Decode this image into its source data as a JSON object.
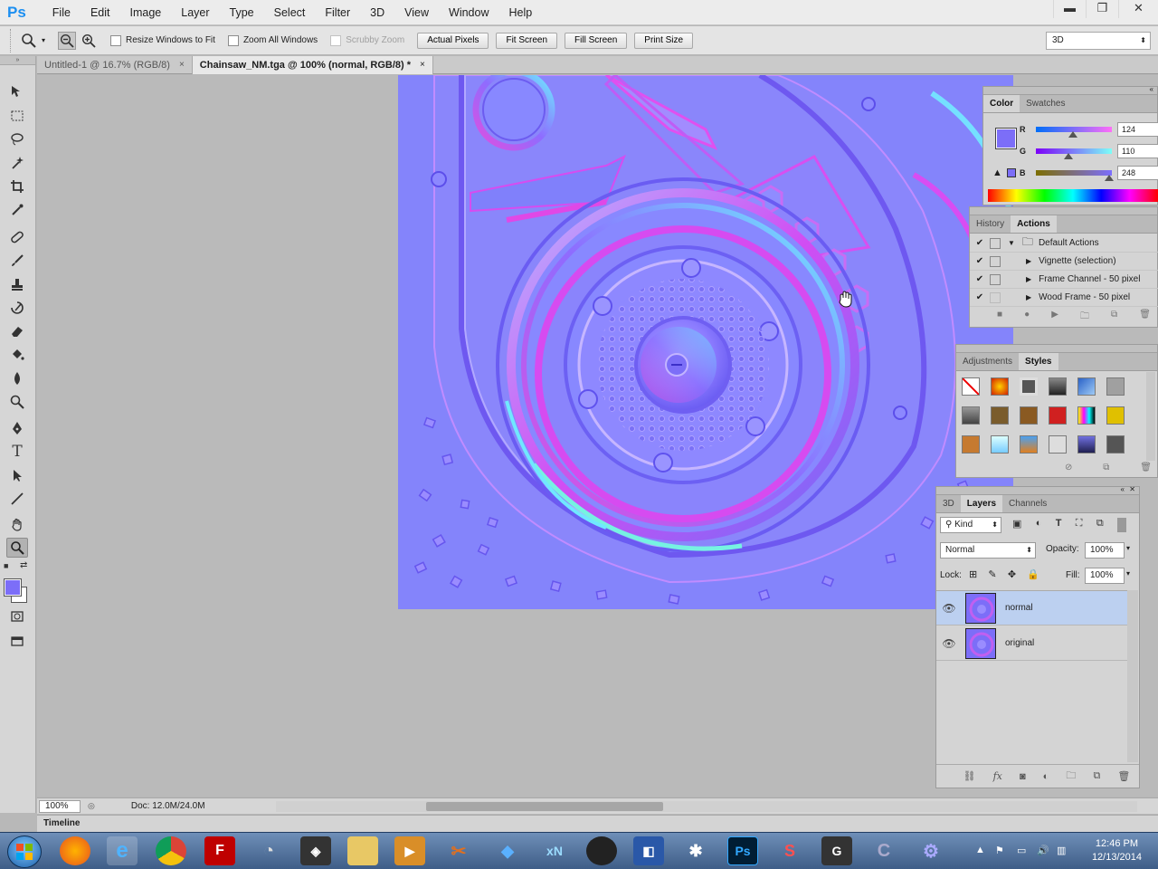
{
  "app": {
    "logo": "Ps",
    "menu": [
      "File",
      "Edit",
      "Image",
      "Layer",
      "Type",
      "Select",
      "Filter",
      "3D",
      "View",
      "Window",
      "Help"
    ],
    "window_controls": {
      "minimize": "▬",
      "restore": "❐",
      "close": "✕"
    }
  },
  "options_bar": {
    "resize_windows": "Resize Windows to Fit",
    "zoom_all": "Zoom All Windows",
    "scrubby": "Scrubby Zoom",
    "buttons": [
      "Actual Pixels",
      "Fit Screen",
      "Fill Screen",
      "Print Size"
    ],
    "workspace": "3D"
  },
  "tabs": [
    {
      "label": "Untitled-1 @ 16.7% (RGB/8)",
      "close": "×"
    },
    {
      "label": "Chainsaw_NM.tga @ 100% (normal, RGB/8) *",
      "close": "×"
    }
  ],
  "status": {
    "zoom": "100%",
    "doc": "Doc: 12.0M/24.0M"
  },
  "timeline": {
    "label": "Timeline"
  },
  "color_panel": {
    "tabs": [
      "Color",
      "Swatches"
    ],
    "channels": [
      {
        "label": "R",
        "value": "124",
        "level": 0.49
      },
      {
        "label": "G",
        "value": "110",
        "level": 0.43
      },
      {
        "label": "B",
        "value": "248",
        "level": 0.97
      }
    ],
    "fg_color": "#7c6ef8"
  },
  "actions_panel": {
    "tabs": [
      "History",
      "Actions"
    ],
    "items": [
      "Default Actions",
      "Vignette (selection)",
      "Frame Channel - 50 pixel",
      "Wood Frame - 50 pixel"
    ]
  },
  "styles_panel": {
    "tabs": [
      "Adjustments",
      "Styles"
    ]
  },
  "layers_panel": {
    "tabs": [
      "3D",
      "Layers",
      "Channels"
    ],
    "kind": "Kind",
    "blend_mode": "Normal",
    "opacity_label": "Opacity:",
    "opacity": "100%",
    "lock_label": "Lock:",
    "fill_label": "Fill:",
    "fill": "100%",
    "layers": [
      {
        "name": "normal",
        "selected": true
      },
      {
        "name": "original",
        "selected": false
      }
    ]
  },
  "taskbar": {
    "time": "12:46 PM",
    "date": "12/13/2014"
  },
  "colors": {
    "accent_ps": "#1c8ff1",
    "normal_map_base": "#8888ff",
    "selected_layer": "#bcd0f0"
  }
}
